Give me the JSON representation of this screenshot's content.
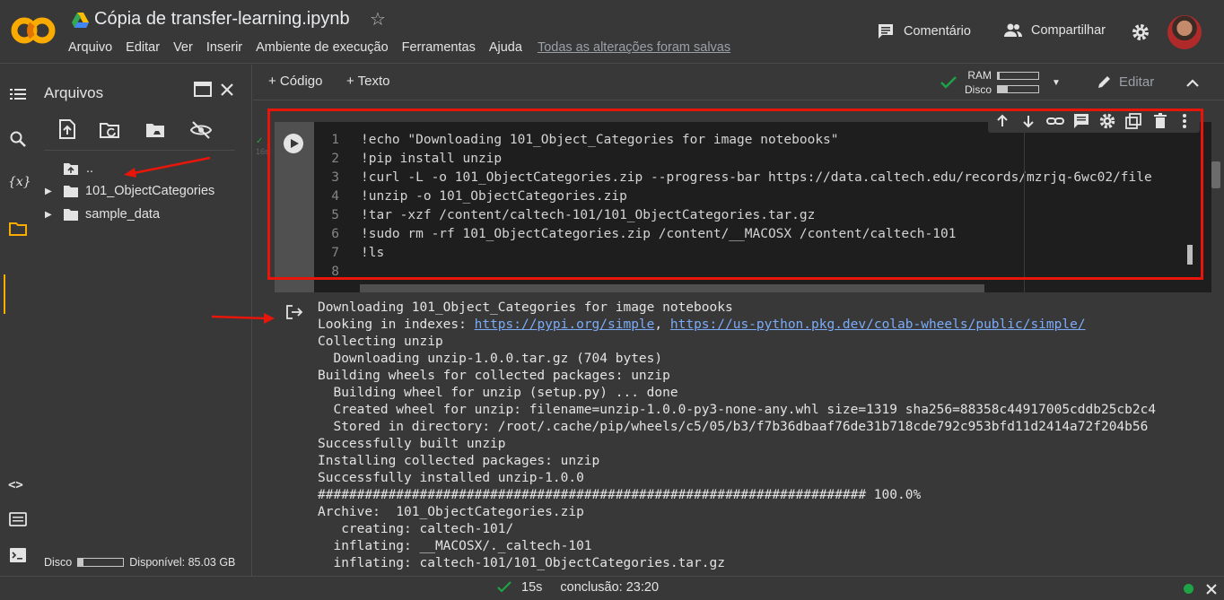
{
  "header": {
    "title": "Cópia de transfer-learning.ipynb",
    "menu": [
      "Arquivo",
      "Editar",
      "Ver",
      "Inserir",
      "Ambiente de execução",
      "Ferramentas",
      "Ajuda"
    ],
    "saved_status": "Todas as alterações foram salvas",
    "comment_label": "Comentário",
    "share_label": "Compartilhar",
    "logo_text": "CO"
  },
  "files_panel": {
    "title": "Arquivos",
    "items": [
      {
        "label": ".."
      },
      {
        "label": "101_ObjectCategories"
      },
      {
        "label": "sample_data"
      }
    ],
    "disk_label": "Disco",
    "disk_available": "Disponível: 85.03 GB",
    "disk_used_fraction": 0.12
  },
  "toolbar": {
    "code_label": "+ Código",
    "text_label": "+ Texto",
    "ram_label": "RAM",
    "disk_label": "Disco",
    "ram_used_fraction": 0.05,
    "disk_used_fraction": 0.25,
    "edit_label": "Editar"
  },
  "cell": {
    "line_numbers": [
      "1",
      "2",
      "3",
      "4",
      "5",
      "6",
      "7",
      "8"
    ],
    "lines": [
      "!echo \"Downloading 101_Object_Categories for image notebooks\"",
      "!pip install unzip",
      "!curl -L -o 101_ObjectCategories.zip --progress-bar https://data.caltech.edu/records/mzrjq-6wc02/file",
      "!unzip -o 101_ObjectCategories.zip",
      "!tar -xzf /content/caltech-101/101_ObjectCategories.tar.gz",
      "!sudo rm -rf 101_ObjectCategories.zip /content/__MACOSX /content/caltech-101",
      "!ls",
      ""
    ],
    "exec_hint": "16s"
  },
  "output": {
    "line1": "Downloading 101_Object_Categories for image notebooks",
    "line2_prefix": "Looking in indexes: ",
    "link1": "https://pypi.org/simple",
    "line2_sep": ", ",
    "link2": "https://us-python.pkg.dev/colab-wheels/public/simple/",
    "lines": [
      "Collecting unzip",
      "  Downloading unzip-1.0.0.tar.gz (704 bytes)",
      "Building wheels for collected packages: unzip",
      "  Building wheel for unzip (setup.py) ... done",
      "  Created wheel for unzip: filename=unzip-1.0.0-py3-none-any.whl size=1319 sha256=88358c44917005cddb25cb2c4",
      "  Stored in directory: /root/.cache/pip/wheels/c5/05/b3/f7b36dbaaf76de31b718cde792c953bfd11d2414a72f204b56",
      "Successfully built unzip",
      "Installing collected packages: unzip",
      "Successfully installed unzip-1.0.0",
      "###################################################################### 100.0%",
      "Archive:  101_ObjectCategories.zip",
      "   creating: caltech-101/",
      "  inflating: __MACOSX/._caltech-101",
      "  inflating: caltech-101/101_ObjectCategories.tar.gz"
    ]
  },
  "status": {
    "time": "15s",
    "completion": "conclusão: 23:20"
  },
  "colors": {
    "accent_orange": "#f9ab00",
    "annotation_red": "#e8150b",
    "ok_green": "#1ea446",
    "link_blue": "#7cacf8"
  }
}
